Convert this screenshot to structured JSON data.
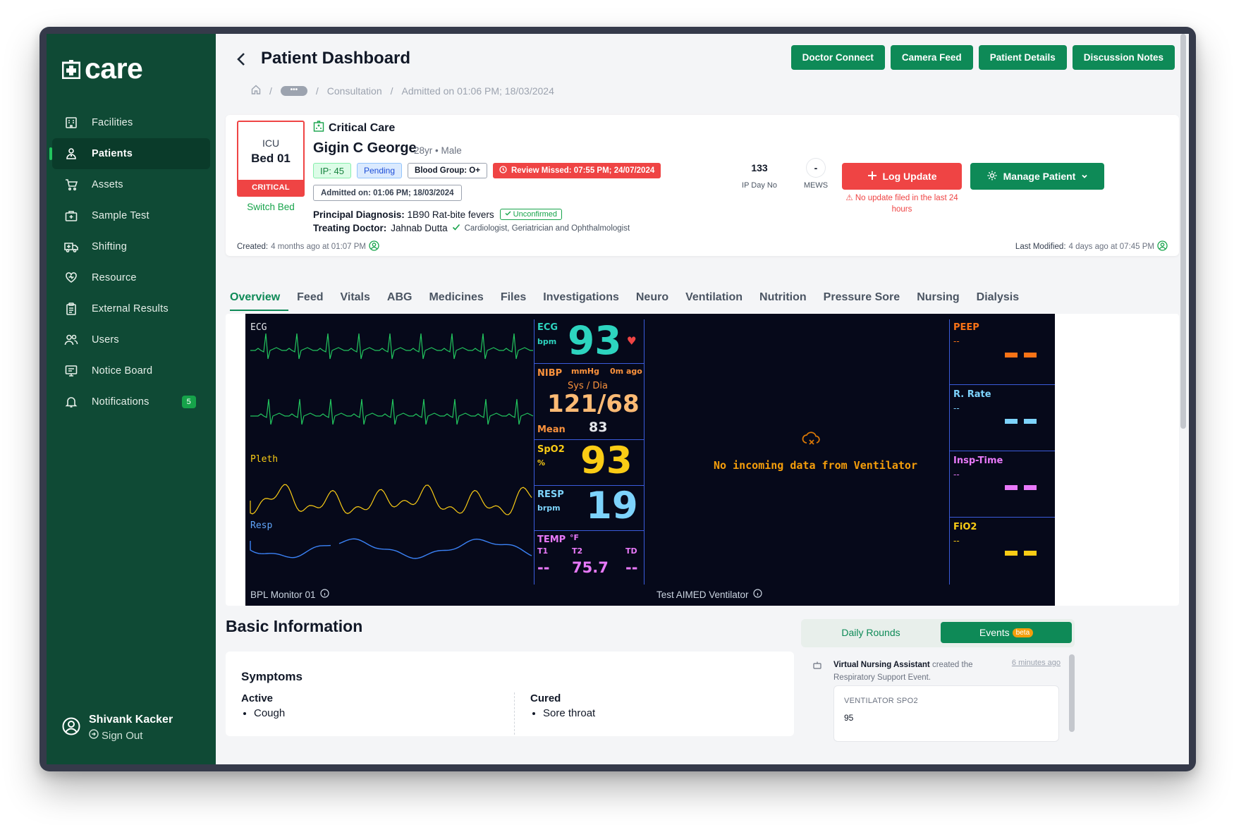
{
  "app": {
    "name": "care"
  },
  "nav": [
    {
      "label": "Facilities",
      "icon": "building-icon"
    },
    {
      "label": "Patients",
      "icon": "patient-icon",
      "active": true
    },
    {
      "label": "Assets",
      "icon": "cart-icon"
    },
    {
      "label": "Sample Test",
      "icon": "medical-kit-icon"
    },
    {
      "label": "Shifting",
      "icon": "ambulance-icon"
    },
    {
      "label": "Resource",
      "icon": "heart-hand-icon"
    },
    {
      "label": "External Results",
      "icon": "clipboard-icon"
    },
    {
      "label": "Users",
      "icon": "users-icon"
    },
    {
      "label": "Notice Board",
      "icon": "notice-board-icon"
    },
    {
      "label": "Notifications",
      "icon": "bell-icon",
      "count": "5"
    }
  ],
  "user": {
    "name": "Shivank Kacker",
    "sign_out": "Sign Out"
  },
  "header": {
    "title": "Patient Dashboard",
    "buttons": [
      "Doctor Connect",
      "Camera Feed",
      "Patient Details",
      "Discussion Notes"
    ],
    "breadcrumbs": {
      "dots": "•••",
      "consultation": "Consultation",
      "admitted": "Admitted on 01:06 PM; 18/03/2024"
    }
  },
  "patient": {
    "ward": "ICU",
    "bed": "Bed 01",
    "status": "CRITICAL",
    "switch_bed": "Switch Bed",
    "facility": "Critical Care",
    "name": "Gigin C George",
    "meta": "28yr • Male",
    "ip": "IP: 45",
    "pending": "Pending",
    "blood_group": "Blood Group: O+",
    "review_missed": "Review Missed: 07:55 PM; 24/07/2024",
    "admitted_on": "Admitted on: 01:06 PM; 18/03/2024",
    "diagnosis_label": "Principal Diagnosis:",
    "diagnosis": "1B90 Rat-bite fevers",
    "diagnosis_status": "Unconfirmed",
    "doctor_label": "Treating Doctor:",
    "doctor": "Jahnab Dutta",
    "doctor_specialty": "Cardiologist, Geriatrician and Ophthalmologist",
    "created_label": "Created:",
    "created": "4 months ago at 01:07 PM",
    "modified_label": "Last Modified:",
    "modified": "4 days ago at 07:45 PM",
    "ip_day_no": "133",
    "ip_day_label": "IP Day No",
    "mews": "-",
    "mews_label": "MEWS",
    "log_update": "Log Update",
    "log_warning": "No update filed in the last 24 hours",
    "manage": "Manage Patient"
  },
  "tabs": [
    "Overview",
    "Feed",
    "Vitals",
    "ABG",
    "Medicines",
    "Files",
    "Investigations",
    "Neuro",
    "Ventilation",
    "Nutrition",
    "Pressure Sore",
    "Nursing",
    "Dialysis"
  ],
  "monitor": {
    "wave_labels": {
      "ecg": "ECG",
      "pleth": "Pleth",
      "resp": "Resp"
    },
    "ecg": {
      "label": "ECG",
      "unit": "bpm",
      "value": "93"
    },
    "nibp": {
      "label": "NIBP",
      "unit": "mmHg",
      "ago": "0m ago",
      "sub": "Sys / Dia",
      "value": "121/68",
      "mean_label": "Mean",
      "mean": "83"
    },
    "spo2": {
      "label": "SpO2",
      "unit": "%",
      "value": "93"
    },
    "resp": {
      "label": "RESP",
      "unit": "brpm",
      "value": "19"
    },
    "temp": {
      "label": "TEMP",
      "unit": "°F",
      "t1": "T1",
      "t2": "T2",
      "td": "TD",
      "t1_val": "--",
      "t2_val": "75.7",
      "td_val": "--"
    },
    "ventilator_message": "No incoming data from Ventilator",
    "vent_params": [
      {
        "label": "PEEP",
        "value": "--",
        "color": "#f97316"
      },
      {
        "label": "R. Rate",
        "value": "--",
        "color": "#7dd3fc"
      },
      {
        "label": "Insp-Time",
        "value": "--",
        "color": "#e879f9"
      },
      {
        "label": "FiO2",
        "value": "--",
        "color": "#facc15"
      }
    ],
    "monitor_device": "BPL Monitor 01",
    "ventilator_device": "Test AIMED Ventilator"
  },
  "basic_info": {
    "title": "Basic Information",
    "symptoms_title": "Symptoms",
    "active_label": "Active",
    "active": [
      "Cough"
    ],
    "cured_label": "Cured",
    "cured": [
      "Sore throat"
    ]
  },
  "rounds": {
    "daily": "Daily Rounds",
    "events": "Events",
    "beta": "beta"
  },
  "event": {
    "actor": "Virtual Nursing Assistant",
    "action": "created the Respiratory Support Event.",
    "time": "6 minutes ago",
    "field_label": "VENTILATOR SPO2",
    "field_value": "95"
  }
}
